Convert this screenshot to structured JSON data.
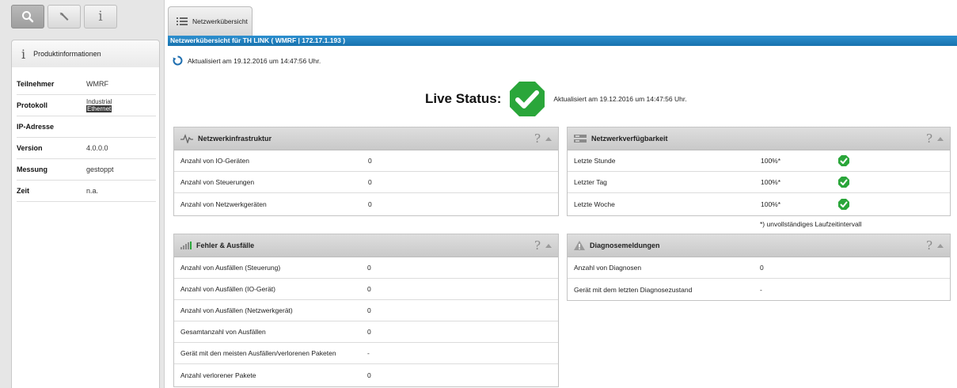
{
  "sidebar": {
    "tools": [
      {
        "name": "search-icon",
        "active": true
      },
      {
        "name": "wrench-icon",
        "active": false
      },
      {
        "name": "info-icon",
        "active": false,
        "glyph": "i"
      }
    ],
    "section_glyph": "i",
    "section_title": "Produktinformationen",
    "rows": [
      {
        "key": "Teilnehmer",
        "value": "WMRF"
      },
      {
        "key": "Protokoll",
        "value_line1": "Industrial",
        "value_line2": "Ethernet"
      },
      {
        "key": "IP-Adresse",
        "value": ""
      },
      {
        "key": "Version",
        "value": "4.0.0.0"
      },
      {
        "key": "Messung",
        "value": "gestoppt"
      },
      {
        "key": "Zeit",
        "value": "n.a."
      }
    ]
  },
  "tab": {
    "label": "Netzwerkübersicht"
  },
  "titlebar": "Netzwerkübersicht für TH LINK ( WMRF | 172.17.1.193 )",
  "updated_top": "Aktualisiert am 19.12.2016 um 14:47:56 Uhr.",
  "live": {
    "label": "Live Status:",
    "timestamp": "Aktualisiert am 19.12.2016 um 14:47:56 Uhr."
  },
  "infra": {
    "title": "Netzwerkinfrastruktur",
    "help": "?",
    "rows": [
      {
        "k": "Anzahl von IO-Geräten",
        "v": "0"
      },
      {
        "k": "Anzahl von Steuerungen",
        "v": "0"
      },
      {
        "k": "Anzahl von Netzwerkgeräten",
        "v": "0"
      }
    ]
  },
  "avail": {
    "title": "Netzwerkverfügbarkeit",
    "help": "?",
    "rows": [
      {
        "k": "Letzte Stunde",
        "v": "100%*"
      },
      {
        "k": "Letzter Tag",
        "v": "100%*"
      },
      {
        "k": "Letzte Woche",
        "v": "100%*"
      }
    ],
    "footnote": "*) unvollständiges Laufzeitintervall"
  },
  "faults": {
    "title": "Fehler & Ausfälle",
    "help": "?",
    "rows": [
      {
        "k": "Anzahl von Ausfällen (Steuerung)",
        "v": "0"
      },
      {
        "k": "Anzahl von Ausfällen (IO-Gerät)",
        "v": "0"
      },
      {
        "k": "Anzahl von Ausfällen (Netzwerkgerät)",
        "v": "0"
      },
      {
        "k": "Gesamtanzahl von Ausfällen",
        "v": "0"
      },
      {
        "k": "Gerät mit den meisten Ausfällen/verlorenen Paketen",
        "v": "-"
      },
      {
        "k": "Anzahl verlorener Pakete",
        "v": "0"
      }
    ]
  },
  "diag": {
    "title": "Diagnosemeldungen",
    "help": "?",
    "rows": [
      {
        "k": "Anzahl von Diagnosen",
        "v": "0"
      },
      {
        "k": "Gerät mit dem letzten Diagnosezustand",
        "v": "-"
      }
    ]
  },
  "colors": {
    "accent": "#1f7fc0",
    "ok_green": "#2aa63a"
  }
}
